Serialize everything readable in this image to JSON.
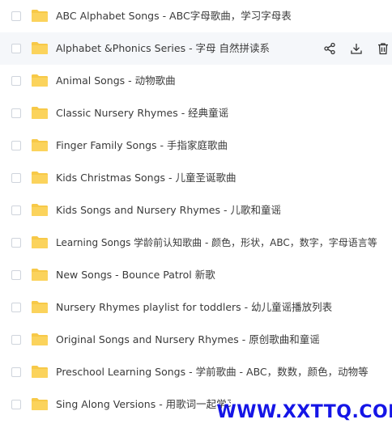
{
  "items": [
    {
      "label": "ABC Alphabet Songs - ABC字母歌曲，学习字母表"
    },
    {
      "label": "Alphabet &Phonics Series - 字母 自然拼读系"
    },
    {
      "label": "Animal Songs - 动物歌曲"
    },
    {
      "label": "Classic Nursery Rhymes - 经典童谣"
    },
    {
      "label": "Finger Family Songs - 手指家庭歌曲"
    },
    {
      "label": "Kids Christmas Songs - 儿童圣诞歌曲"
    },
    {
      "label": "Kids Songs and Nursery Rhymes - 儿歌和童谣"
    },
    {
      "label": "Learning Songs 学龄前认知歌曲 - 颜色，形状，ABC，数字，字母语言等"
    },
    {
      "label": "New Songs - Bounce Patrol 新歌"
    },
    {
      "label": "Nursery Rhymes playlist for toddlers - 幼儿童谣播放列表"
    },
    {
      "label": "Original Songs and Nursery Rhymes - 原创歌曲和童谣"
    },
    {
      "label": "Preschool Learning Songs - 学前歌曲 - ABC，数数，颜色，动物等"
    },
    {
      "label": "Sing Along Versions - 用歌词一起学习"
    }
  ],
  "row_actions": {
    "share_icon": "share-icon",
    "download_icon": "download-icon",
    "delete_icon": "trash-icon"
  },
  "colors": {
    "folder": "#f7c948",
    "folder_tab": "#f2b929",
    "hover_bg": "#f5f7fa",
    "watermark": "#1515e6"
  },
  "watermark": {
    "text": "WWW.XXTTQ.COM"
  }
}
